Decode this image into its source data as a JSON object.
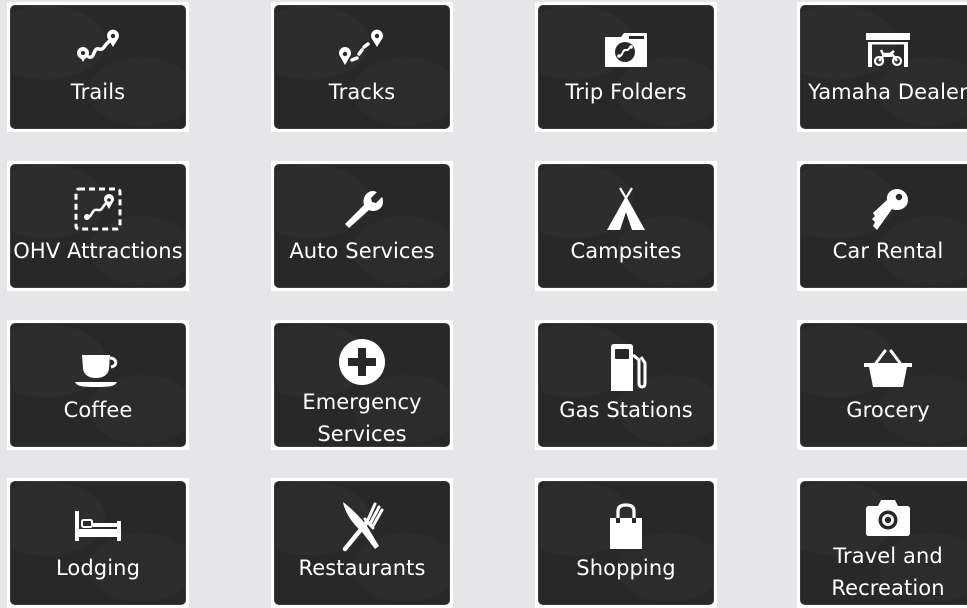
{
  "tiles": [
    {
      "label": "Trails",
      "icon": "trail-route-icon"
    },
    {
      "label": "Tracks",
      "icon": "tracks-icon"
    },
    {
      "label": "Trip Folders",
      "icon": "folder-icon"
    },
    {
      "label": "Yamaha Dealer",
      "icon": "dealer-garage-icon"
    },
    {
      "label": "OHV Attractions",
      "icon": "attraction-icon"
    },
    {
      "label": "Auto Services",
      "icon": "wrench-icon"
    },
    {
      "label": "Campsites",
      "icon": "tent-icon"
    },
    {
      "label": "Car Rental",
      "icon": "key-icon"
    },
    {
      "label": "Coffee",
      "icon": "coffee-cup-icon"
    },
    {
      "label": "Emergency Services",
      "icon": "medical-cross-icon"
    },
    {
      "label": "Gas Stations",
      "icon": "fuel-pump-icon"
    },
    {
      "label": "Grocery",
      "icon": "basket-icon"
    },
    {
      "label": "Lodging",
      "icon": "bed-icon"
    },
    {
      "label": "Restaurants",
      "icon": "fork-knife-icon"
    },
    {
      "label": "Shopping",
      "icon": "shopping-bag-icon"
    },
    {
      "label": "Travel and Recreation",
      "icon": "camera-icon"
    }
  ],
  "colors": {
    "background": "#e6e6e8",
    "tile": "#282828",
    "text": "#ffffff"
  }
}
